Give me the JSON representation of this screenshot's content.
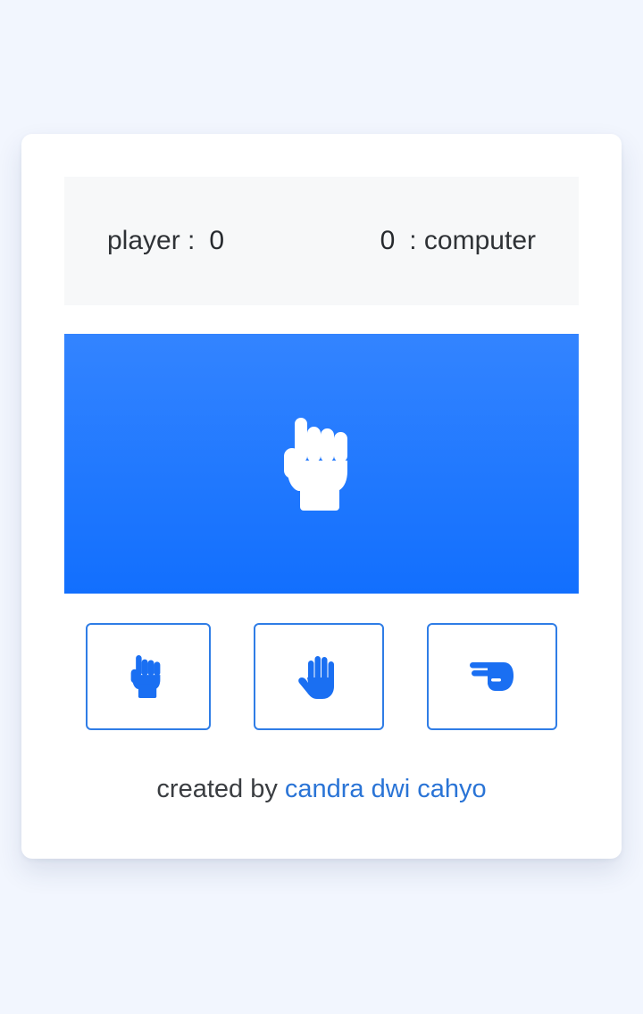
{
  "scoreboard": {
    "player_label": "player :",
    "player_score": "0",
    "computer_score": "0",
    "computer_label": ": computer"
  },
  "arena": {
    "current_hand_icon": "fist-icon",
    "background_gradient": [
      "#3384ff",
      "#126ffe"
    ]
  },
  "choices": [
    {
      "name": "rock",
      "icon": "fist-icon"
    },
    {
      "name": "paper",
      "icon": "open-hand-icon"
    },
    {
      "name": "scissors",
      "icon": "scissors-hand-icon"
    }
  ],
  "footer": {
    "prefix": "created by",
    "author": "candra dwi cahyo"
  },
  "colors": {
    "accent": "#2f7de6",
    "icon": "#1a6ff2",
    "page_background": "#f2f6fe",
    "card": "#ffffff"
  }
}
